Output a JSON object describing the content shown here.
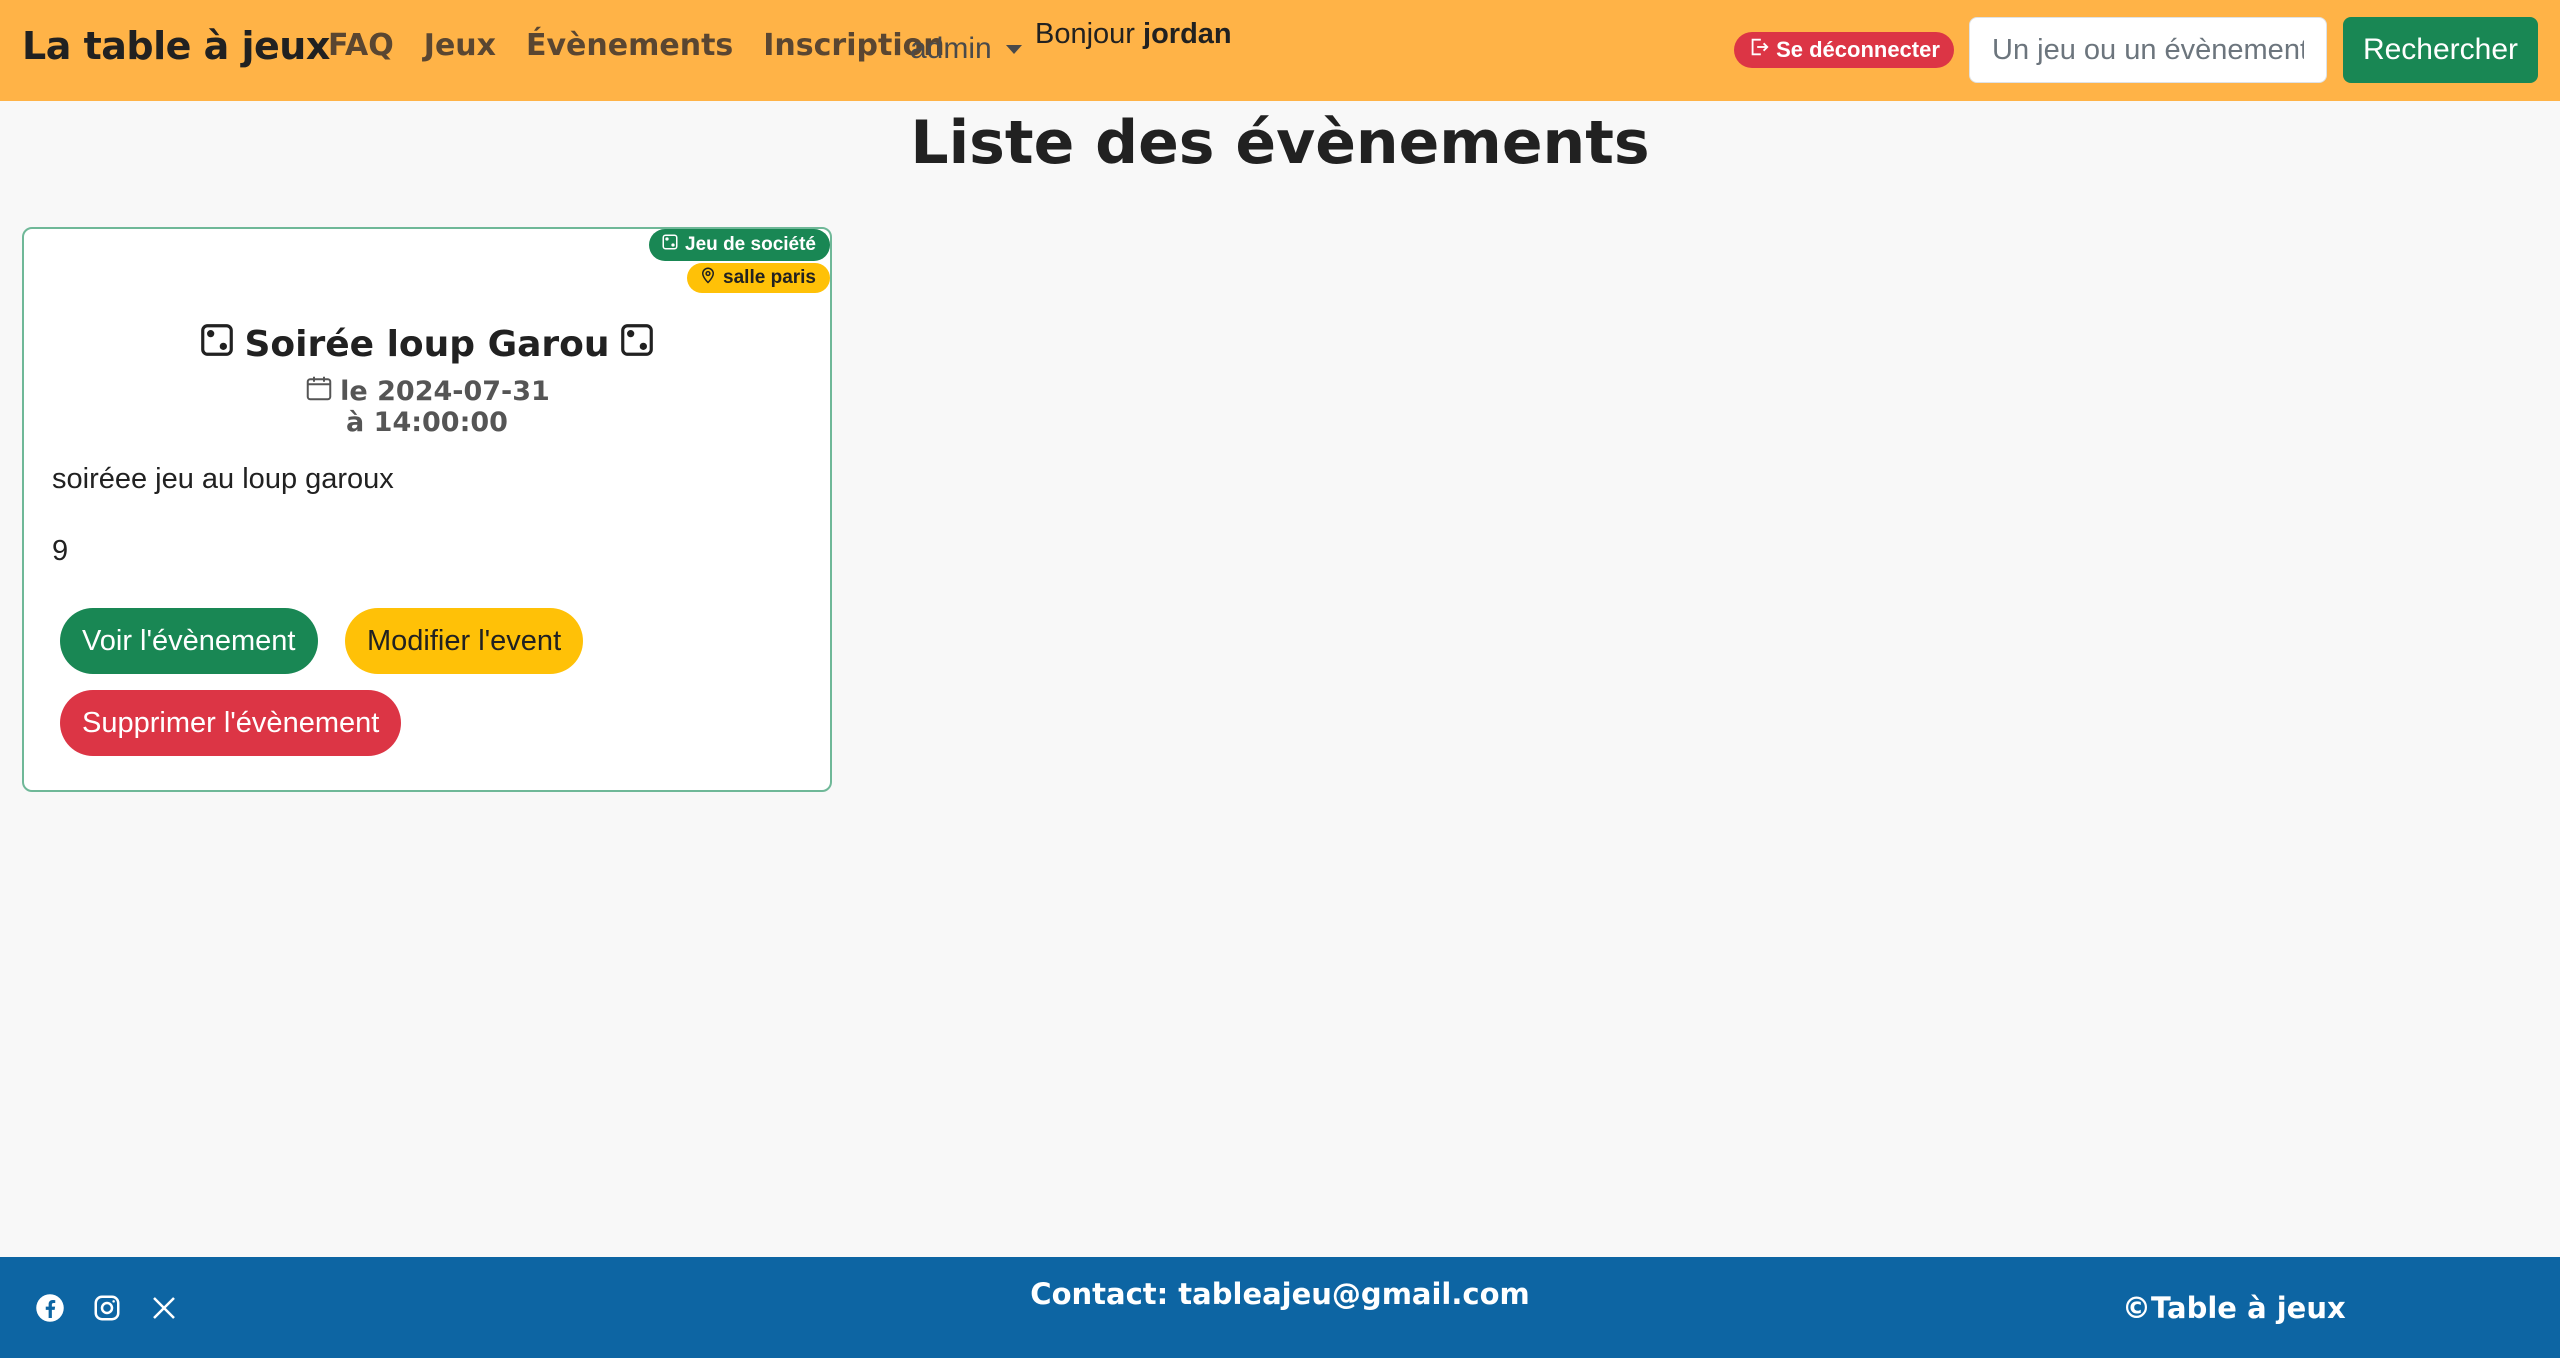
{
  "header": {
    "brand": "La table à jeux",
    "nav": [
      "FAQ",
      "Jeux",
      "Évènements",
      "Inscription"
    ],
    "admin_label": "admin",
    "greeting_prefix": "Bonjour",
    "username": "jordan",
    "logout_label": "Se déconnecter",
    "search_placeholder": "Un jeu ou un évènement",
    "search_button": "Rechercher"
  },
  "main": {
    "title": "Liste des évènements",
    "events": [
      {
        "category_badge": "Jeu de société",
        "location_badge": "salle paris",
        "title": "Soirée loup Garou",
        "date_text": "le 2024-07-31",
        "time_text": "à 14:00:00",
        "description": "soiréee jeu au loup garoux",
        "count": "9",
        "view_button": "Voir l'évènement",
        "edit_button": "Modifier l'event",
        "delete_button": "Supprimer l'évènement"
      }
    ]
  },
  "footer": {
    "contact": "Contact: tableajeu@gmail.com",
    "copyright": "©Table à jeux",
    "social_icons": [
      "facebook-icon",
      "instagram-icon",
      "x-icon"
    ]
  },
  "colors": {
    "header_bg": "#ffb347",
    "footer_bg": "#0d65a3",
    "success": "#198754",
    "warning": "#ffc107",
    "danger": "#dc3545"
  }
}
